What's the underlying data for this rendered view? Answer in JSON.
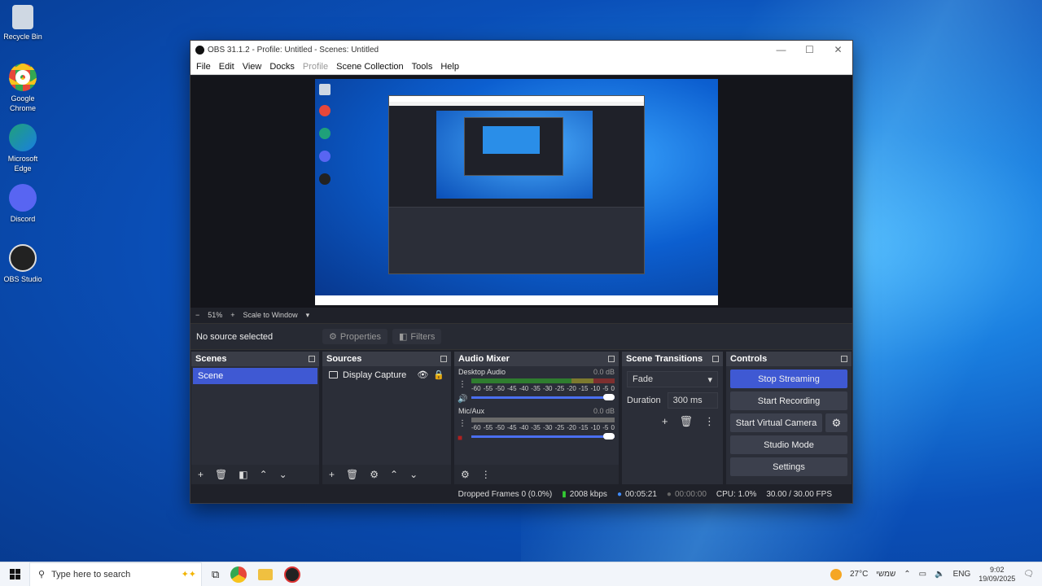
{
  "desktop": {
    "icons": [
      {
        "label": "Recycle Bin",
        "icon": "recycle-bin-icon",
        "color": "#cfd8e3"
      },
      {
        "label": "Google Chrome",
        "icon": "chrome-icon",
        "color": "#e7473a"
      },
      {
        "label": "Microsoft Edge",
        "icon": "edge-icon",
        "color": "#1fa17a"
      },
      {
        "label": "Discord",
        "icon": "discord-icon",
        "color": "#5865f2"
      },
      {
        "label": "OBS Studio",
        "icon": "obs-icon",
        "color": "#222222"
      }
    ]
  },
  "window": {
    "title": "OBS 31.1.2 - Profile: Untitled - Scenes: Untitled",
    "menu": [
      "File",
      "Edit",
      "View",
      "Docks",
      "Profile",
      "Scene Collection",
      "Tools",
      "Help"
    ],
    "disabled_menu": "Profile"
  },
  "zoom": {
    "minus": "−",
    "value": "51%",
    "plus": "+",
    "mode": "Scale to Window"
  },
  "source_toolbar": {
    "no_source": "No source selected",
    "properties": "Properties",
    "filters": "Filters"
  },
  "docks": {
    "scenes": {
      "title": "Scenes",
      "items": [
        "Scene"
      ]
    },
    "sources": {
      "title": "Sources",
      "items": [
        "Display Capture"
      ]
    },
    "mixer": {
      "title": "Audio Mixer",
      "channels": [
        {
          "name": "Desktop Audio",
          "db": "0.0 dB"
        },
        {
          "name": "Mic/Aux",
          "db": "0.0 dB"
        }
      ],
      "ticks": [
        "-60",
        "-55",
        "-50",
        "-45",
        "-40",
        "-35",
        "-30",
        "-25",
        "-20",
        "-15",
        "-10",
        "-5",
        "0"
      ]
    },
    "transitions": {
      "title": "Scene Transitions",
      "selected": "Fade",
      "duration_label": "Duration",
      "duration_value": "300 ms"
    },
    "controls": {
      "title": "Controls",
      "stop_streaming": "Stop Streaming",
      "start_recording": "Start Recording",
      "start_virtual_camera": "Start Virtual Camera",
      "studio_mode": "Studio Mode",
      "settings": "Settings"
    }
  },
  "status": {
    "dropped": "Dropped Frames 0 (0.0%)",
    "bitrate": "2008 kbps",
    "stream_time": "00:05:21",
    "rec_time": "00:00:00",
    "cpu": "CPU: 1.0%",
    "fps": "30.00 / 30.00 FPS"
  },
  "taskbar": {
    "search_placeholder": "Type here to search",
    "weather": "27°C",
    "weather_text": "שמשי",
    "lang": "ENG",
    "time": "9:02",
    "date": "19/09/2025"
  },
  "colors": {
    "accent": "#3f59d3",
    "meter_green": "#2f7d2f",
    "bitrate_green": "#33cc33"
  }
}
